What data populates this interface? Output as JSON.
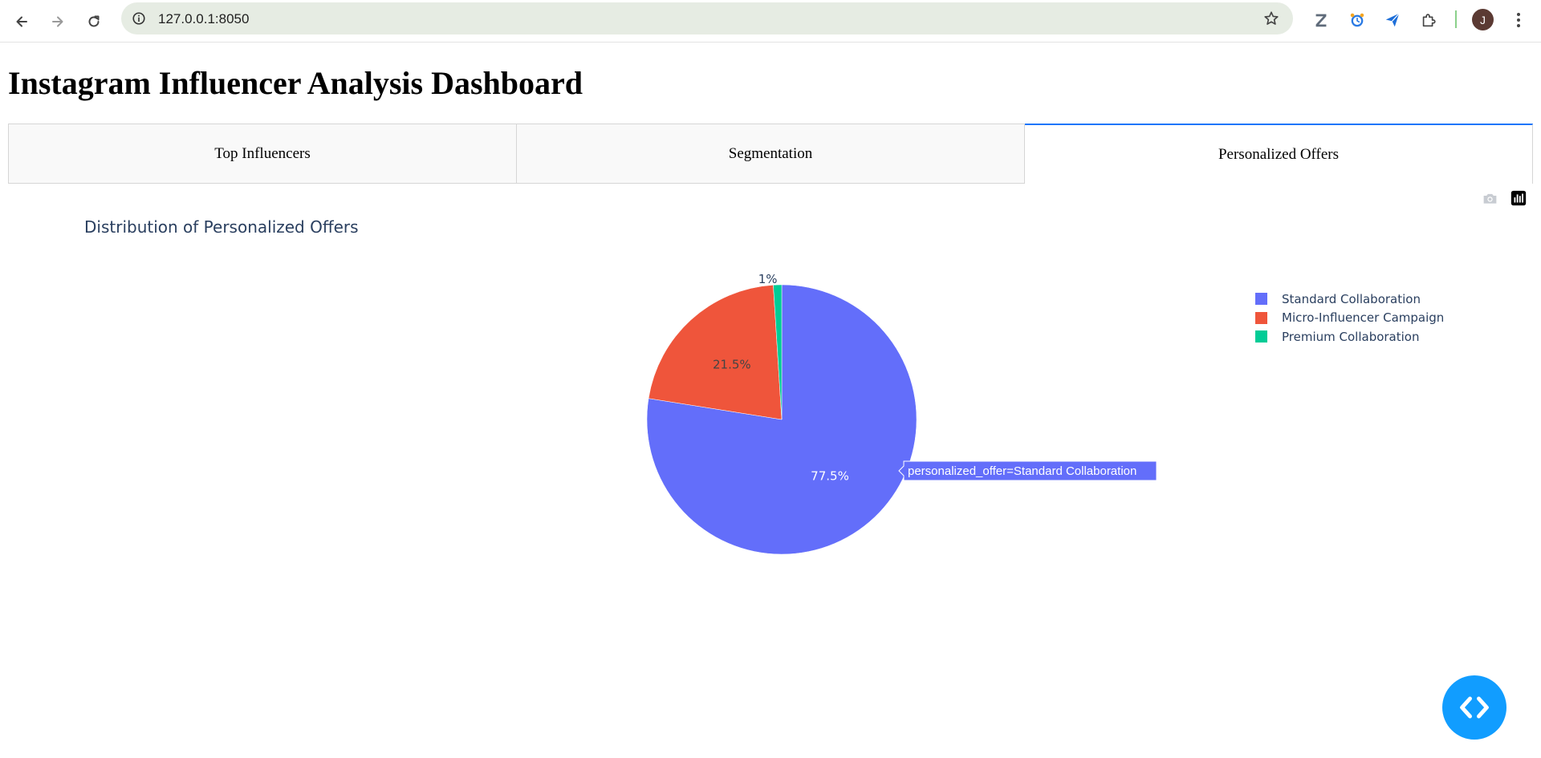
{
  "browser": {
    "url": "127.0.0.1:8050",
    "profile_initial": "J",
    "icons": {
      "back": "back-arrow-icon",
      "forward": "forward-arrow-icon",
      "reload": "reload-icon",
      "site_info": "info-icon",
      "bookmark": "star-icon",
      "extensions": [
        "zotero-icon",
        "clock-extension-icon",
        "send-extension-icon",
        "puzzle-icon"
      ],
      "menu": "kebab-menu-icon"
    }
  },
  "page": {
    "title": "Instagram Influencer Analysis Dashboard"
  },
  "tabs": [
    {
      "label": "Top Influencers",
      "selected": false
    },
    {
      "label": "Segmentation",
      "selected": false
    },
    {
      "label": "Personalized Offers",
      "selected": true
    }
  ],
  "colors": {
    "accent": "#1975fa",
    "series_standard": "#636efa",
    "series_micro": "#ef553b",
    "series_premium": "#00cc96",
    "fab": "#119dff",
    "title_text": "#2a3f5f"
  },
  "modebar": {
    "icons": [
      "camera-icon",
      "plotly-logo-icon"
    ]
  },
  "hover": {
    "label": "personalized_offer=Standard Collaboration"
  },
  "chart_data": {
    "type": "pie",
    "title": "Distribution of Personalized Offers",
    "categories": [
      "Standard Collaboration",
      "Micro-Influencer Campaign",
      "Premium Collaboration"
    ],
    "values": [
      77.5,
      21.5,
      1.0
    ],
    "value_labels": [
      "77.5%",
      "21.5%",
      "1%"
    ],
    "colors": [
      "#636efa",
      "#ef553b",
      "#00cc96"
    ],
    "legend_position": "top-right",
    "direction": "clockwise",
    "rotation_start": "top"
  },
  "fab": {
    "icon": "code-brackets-icon"
  }
}
